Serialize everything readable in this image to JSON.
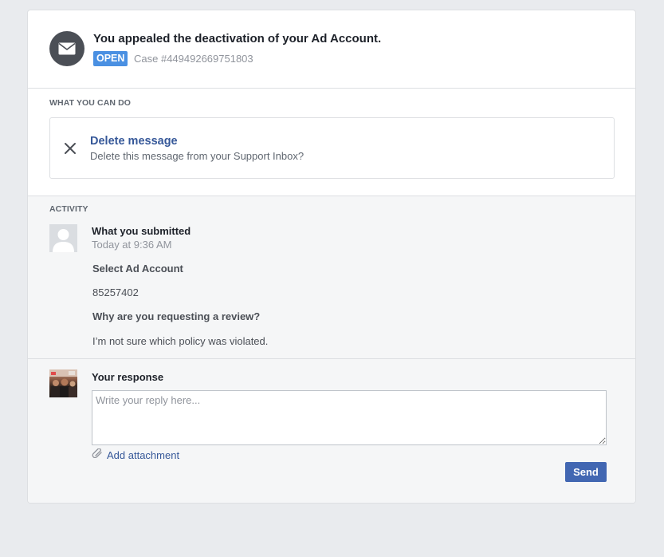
{
  "header": {
    "icon": "envelope-icon",
    "title": "You appealed the deactivation of your Ad Account.",
    "status_badge": "OPEN",
    "case_label": "Case #449492669751803"
  },
  "actions": {
    "section_label": "WHAT YOU CAN DO",
    "delete": {
      "icon": "close-icon",
      "title": "Delete message",
      "description": "Delete this message from your Support Inbox?"
    }
  },
  "activity": {
    "section_label": "ACTIVITY",
    "submission": {
      "title": "What you submitted",
      "time": "Today at 9:36 AM",
      "fields": [
        {
          "label": "Select Ad Account",
          "value": "85257402"
        },
        {
          "label": "Why are you requesting a review?",
          "value": "I’m not sure which policy was violated."
        }
      ]
    },
    "response": {
      "title": "Your response",
      "placeholder": "Write your reply here...",
      "attach_label": "Add attachment",
      "send_label": "Send"
    }
  },
  "colors": {
    "accent_blue": "#4267b2",
    "badge_blue": "#4a90e2",
    "link_blue": "#365899",
    "page_bg": "#e9ebee",
    "activity_bg": "#f5f6f7"
  }
}
